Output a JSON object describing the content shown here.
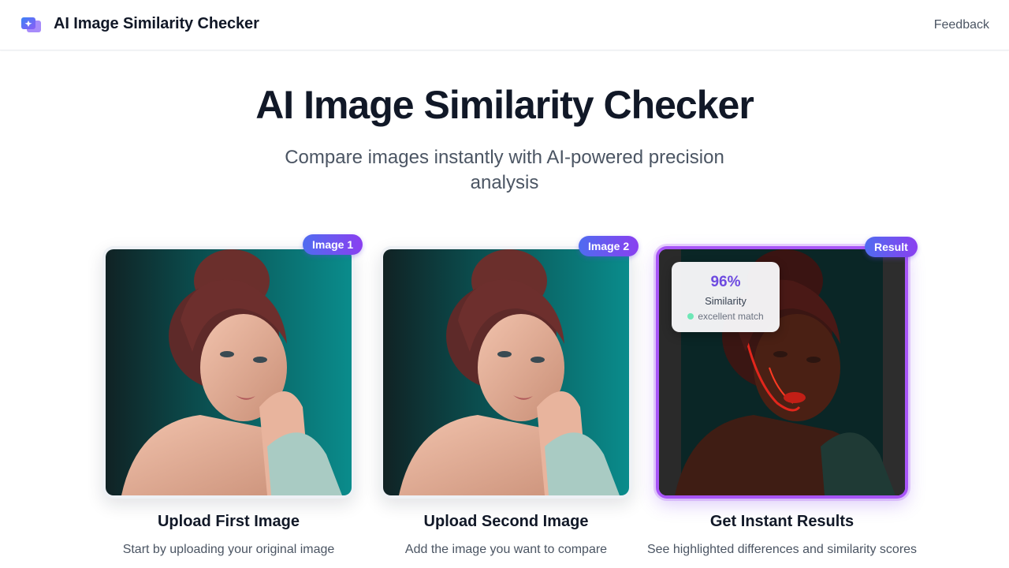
{
  "header": {
    "app_name": "AI Image Similarity Checker",
    "feedback_label": "Feedback"
  },
  "hero": {
    "title": "AI Image Similarity Checker",
    "subtitle": "Compare images instantly with AI-powered precision analysis"
  },
  "steps": [
    {
      "badge": "Image 1",
      "title": "Upload First Image",
      "description": "Start by uploading your original image"
    },
    {
      "badge": "Image 2",
      "title": "Upload Second Image",
      "description": "Add the image you want to compare"
    },
    {
      "badge": "Result",
      "title": "Get Instant Results",
      "description": "See highlighted differences and similarity scores"
    }
  ],
  "result": {
    "similarity_value": "96%",
    "similarity_label": "Similarity",
    "match_status": "excellent match"
  },
  "colors": {
    "badge_gradient_start": "#4f6cf0",
    "badge_gradient_end": "#8a3ff0",
    "result_border": "#a855f7",
    "similarity_text": "#6d4ae0",
    "status_dot": "#6ee7b7"
  }
}
